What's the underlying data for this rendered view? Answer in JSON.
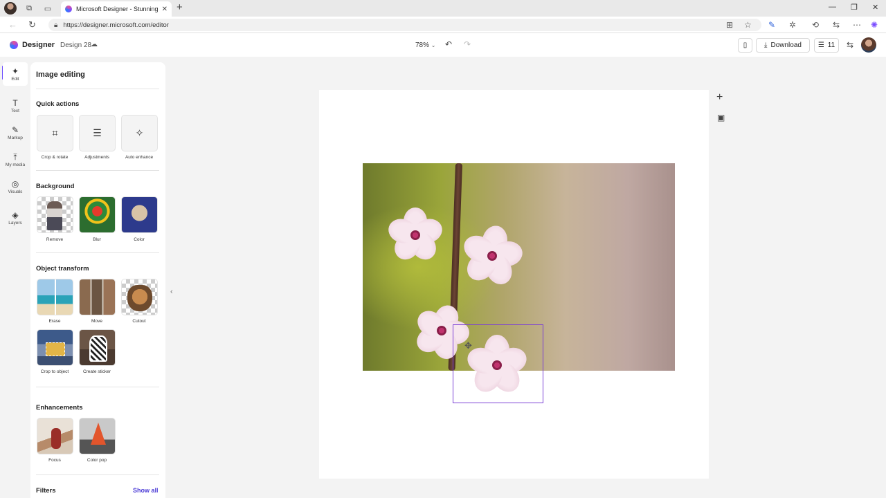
{
  "browser": {
    "tab_title": "Microsoft Designer - Stunning de",
    "url": "https://designer.microsoft.com/editor"
  },
  "header": {
    "brand": "Designer",
    "design_name": "Design 28",
    "zoom": "78%",
    "download_label": "Download",
    "layers_count": "11"
  },
  "rail": {
    "items": [
      {
        "label": "Edit",
        "icon": "sparkle-edit-icon"
      },
      {
        "label": "Text",
        "icon": "text-icon"
      },
      {
        "label": "Markup",
        "icon": "pen-icon"
      },
      {
        "label": "My media",
        "icon": "upload-icon"
      },
      {
        "label": "Visuals",
        "icon": "shapes-icon"
      },
      {
        "label": "Layers",
        "icon": "layers-icon"
      }
    ]
  },
  "panel": {
    "title": "Image editing",
    "quick_actions": {
      "title": "Quick actions",
      "items": [
        {
          "label": "Crop & rotate",
          "icon": "crop-icon"
        },
        {
          "label": "Adjustments",
          "icon": "sliders-icon"
        },
        {
          "label": "Auto enhance",
          "icon": "magic-wand-icon"
        }
      ]
    },
    "background": {
      "title": "Background",
      "items": [
        {
          "label": "Remove"
        },
        {
          "label": "Blur"
        },
        {
          "label": "Color"
        }
      ]
    },
    "object_transform": {
      "title": "Object transform",
      "items": [
        {
          "label": "Erase"
        },
        {
          "label": "Move"
        },
        {
          "label": "Cutout"
        },
        {
          "label": "Crop to object"
        },
        {
          "label": "Create sticker"
        }
      ]
    },
    "enhancements": {
      "title": "Enhancements",
      "items": [
        {
          "label": "Focus"
        },
        {
          "label": "Color pop"
        }
      ]
    },
    "filters": {
      "title": "Filters",
      "show_all": "Show all"
    }
  },
  "colors": {
    "accent": "#6b4cff",
    "selection": "#7b3fd6",
    "link": "#4b3bd6"
  }
}
